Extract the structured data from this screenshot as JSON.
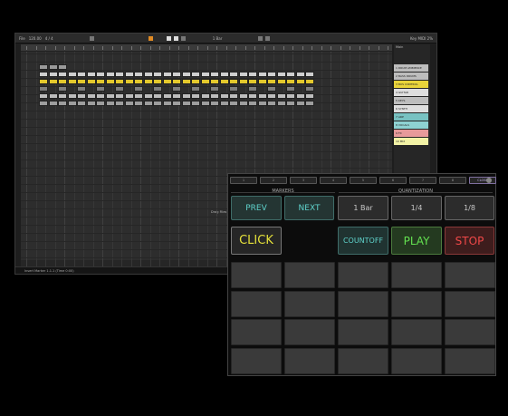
{
  "daw": {
    "toolbar": {
      "tempo": "120.00",
      "signature": "4 / 4",
      "pos_readout": "1 Bar",
      "cpu_readout": "Key MIDI 2%"
    },
    "status_text": "Drag Files and Devices Here",
    "statusbar_text": "Insert Marker 1.1.1 (Time 0:00)",
    "browser_header": "Main",
    "scenes": [
      {
        "label": "1 DRUM AMBIENCE",
        "color": "#bdbdbd"
      },
      {
        "label": "2 BASS DRUMS",
        "color": "#bdbdbd"
      },
      {
        "label": "3 BUS CONTROL",
        "color": "#e9d43a"
      },
      {
        "label": "4 GUITAR",
        "color": "#dedede"
      },
      {
        "label": "5 KEYS",
        "color": "#bdbdbd"
      },
      {
        "label": "6 SYNTH",
        "color": "#dedede"
      },
      {
        "label": "7 ARP",
        "color": "#78c2c2"
      },
      {
        "label": "8 VOCALS",
        "color": "#8ed2d2"
      },
      {
        "label": "9 FX",
        "color": "#e79a9a"
      },
      {
        "label": "10 MIX",
        "color": "#f3f3a6"
      }
    ]
  },
  "controller": {
    "tabs": [
      {
        "label": "1",
        "active": false
      },
      {
        "label": "2",
        "active": false
      },
      {
        "label": "3",
        "active": false
      },
      {
        "label": "4",
        "active": false
      },
      {
        "label": "5",
        "active": false
      },
      {
        "label": "6",
        "active": false
      },
      {
        "label": "7",
        "active": false
      },
      {
        "label": "8",
        "active": false
      },
      {
        "label": "CLOSE",
        "active": true
      }
    ],
    "markers_label": "MARKERS",
    "quantization_label": "QUANTIZATION",
    "prev_label": "PREV",
    "next_label": "NEXT",
    "quant_1bar": "1 Bar",
    "quant_quarter": "1/4",
    "quant_eighth": "1/8",
    "click_label": "CLICK",
    "countoff_label": "COUNTOFF",
    "play_label": "PLAY",
    "stop_label": "STOP",
    "pad_rows": 4,
    "pad_cols": 5
  }
}
